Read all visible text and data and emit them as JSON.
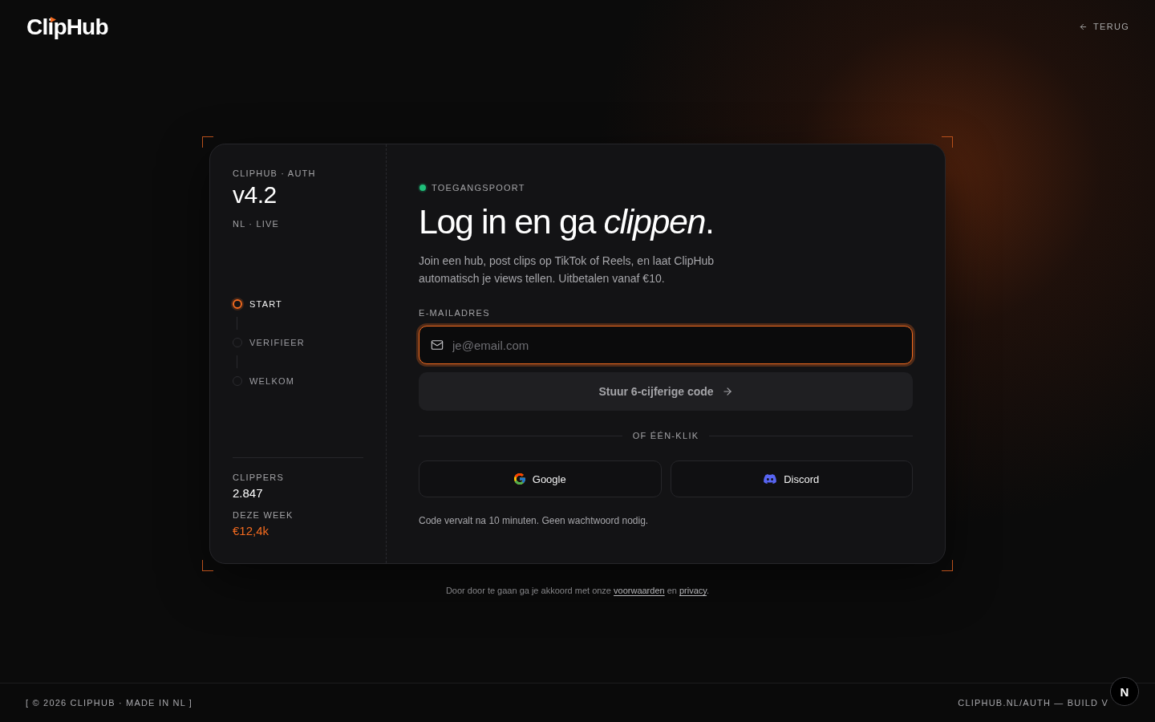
{
  "header": {
    "logo": "ClipHub",
    "back_link": "TERUG"
  },
  "sidebar": {
    "eyebrow": "CLIPHUB · AUTH",
    "version": "v4.2",
    "locale": "NL · LIVE",
    "steps": [
      {
        "label": "START",
        "active": true
      },
      {
        "label": "VERIFIEER",
        "active": false
      },
      {
        "label": "WELKOM",
        "active": false
      }
    ],
    "stats": [
      {
        "kind": "count",
        "label": "CLIPPERS",
        "value": "2.847"
      },
      {
        "kind": "money",
        "label": "DEZE WEEK",
        "value": "€12,4k"
      }
    ]
  },
  "login": {
    "status": "TOEGANGSPOORT",
    "heading": "Log in en ga *clippen*.",
    "intro": "Join een hub, post clips op TikTok of Reels, en laat ClipHub automatisch je views tellen. Uitbetalen vanaf €10.",
    "email_field": {
      "label": "E-MAILADRES",
      "placeholder": "je@email.com",
      "focused": true
    },
    "send_button": {
      "label": "Stuur 6-cijferige code",
      "disabled": true
    },
    "divider": "OF ÉÉN-KLIK",
    "social_buttons": [
      {
        "kind": "google",
        "label": "Google"
      },
      {
        "kind": "discord",
        "label": "Discord"
      }
    ],
    "note": "Code vervalt na 10 minuten. Geen wachtwoord nodig."
  },
  "terms": [
    {
      "kind": "text",
      "text": "Door door te gaan ga je akkoord met onze "
    },
    {
      "kind": "link",
      "text": "voorwaarden"
    },
    {
      "kind": "text",
      "text": " en "
    },
    {
      "kind": "link",
      "text": "privacy"
    },
    {
      "kind": "text",
      "text": "."
    }
  ],
  "footer": {
    "left": "[ © 2026 CLIPHUB · MADE IN NL ]",
    "right": "CLIPHUB.NL/AUTH — BUILD V"
  },
  "dev_badge": {
    "label": "N"
  }
}
